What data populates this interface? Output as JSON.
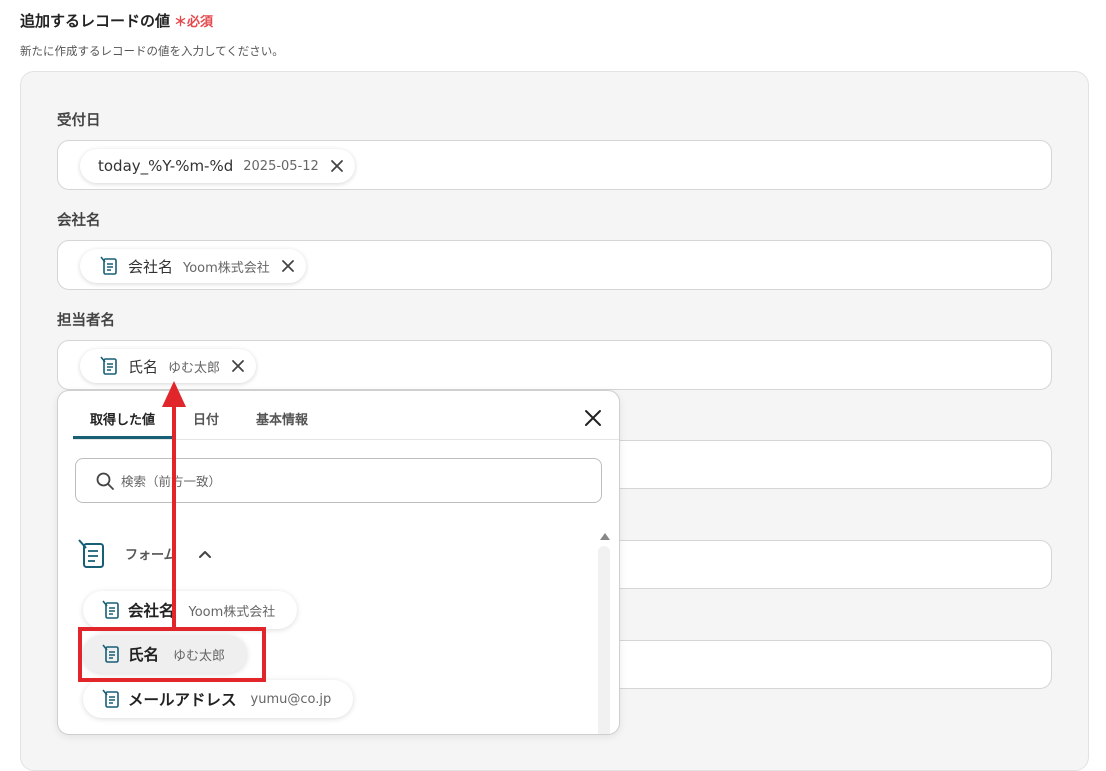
{
  "section": {
    "title": "追加するレコードの値",
    "required_label": "＊必須",
    "description": "新たに作成するレコードの値を入力してください。"
  },
  "fields": [
    {
      "label": "受付日",
      "chip": {
        "name": "today_%Y-%m-%d",
        "value": "2025-05-12",
        "icon": "none"
      }
    },
    {
      "label": "会社名",
      "chip": {
        "name": "会社名",
        "value": "Yoom株式会社",
        "icon": "form-icon"
      }
    },
    {
      "label": "担当者名",
      "chip": {
        "name": "氏名",
        "value": "ゆむ太郎",
        "icon": "form-icon"
      }
    }
  ],
  "popup": {
    "tabs": [
      "取得した値",
      "日付",
      "基本情報"
    ],
    "active_tab": 0,
    "search_placeholder": "検索（前方一致）",
    "group": {
      "label": "フォーム",
      "expanded": true,
      "icon": "form-icon"
    },
    "items": [
      {
        "name": "会社名",
        "value": "Yoom株式会社"
      },
      {
        "name": "氏名",
        "value": "ゆむ太郎",
        "selected": true
      },
      {
        "name": "メールアドレス",
        "value": "yumu@co.jp"
      }
    ]
  },
  "annotation": {
    "color": "#e0262a"
  },
  "colors": {
    "accent": "#175f75",
    "required": "#e5484d",
    "panel_bg": "#f5f5f5"
  }
}
